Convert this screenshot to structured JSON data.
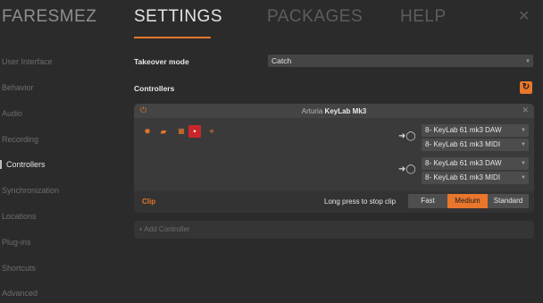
{
  "header": {
    "brand": "FARESMEZ",
    "tabs": [
      {
        "label": "SETTINGS",
        "active": true
      },
      {
        "label": "PACKAGES",
        "active": false
      },
      {
        "label": "HELP",
        "active": false
      }
    ],
    "close_icon": "close-icon"
  },
  "sidebar": {
    "items": [
      {
        "label": "User Interface"
      },
      {
        "label": "Behavior"
      },
      {
        "label": "Audio"
      },
      {
        "label": "Recording"
      },
      {
        "label": "Controllers",
        "active": true
      },
      {
        "label": "Synchronization"
      },
      {
        "label": "Locations"
      },
      {
        "label": "Plug-ins"
      },
      {
        "label": "Shortcuts"
      },
      {
        "label": "Advanced"
      }
    ]
  },
  "main": {
    "takeover_label": "Takeover mode",
    "takeover_value": "Catch",
    "controllers_label": "Controllers",
    "controller": {
      "brand": "Arturia",
      "model": "KeyLab Mk3",
      "ports": [
        {
          "input": "8- KeyLab 61 mk3 DAW",
          "output": "8- KeyLab 61 mk3 MIDI"
        },
        {
          "input": "8- KeyLab 61 mk3 DAW",
          "output": "8- KeyLab 61 mk3 MIDI"
        }
      ],
      "clip_label": "Clip",
      "clip_hint": "Long press to stop clip",
      "clip_options": [
        "Fast",
        "Medium",
        "Standard"
      ],
      "clip_selected": "Medium"
    },
    "add_controller": "+ Add Controller"
  },
  "colors": {
    "accent": "#e8762b",
    "background": "#2b2b2b",
    "panel": "#3a3a3a",
    "danger": "#c9262c"
  }
}
